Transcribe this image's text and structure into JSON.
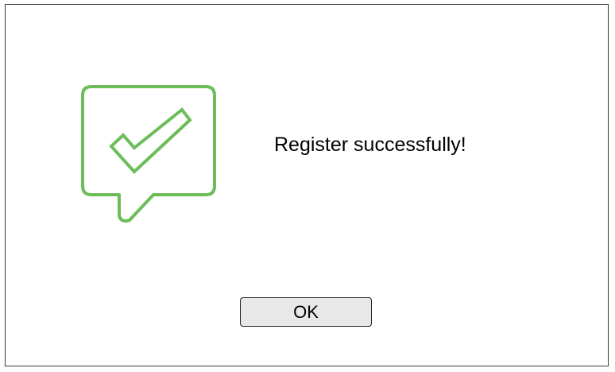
{
  "dialog": {
    "message": "Register successfully!",
    "ok_label": "OK",
    "icon": "speech-bubble-checkmark-icon",
    "icon_color": "#6cbd5a"
  }
}
